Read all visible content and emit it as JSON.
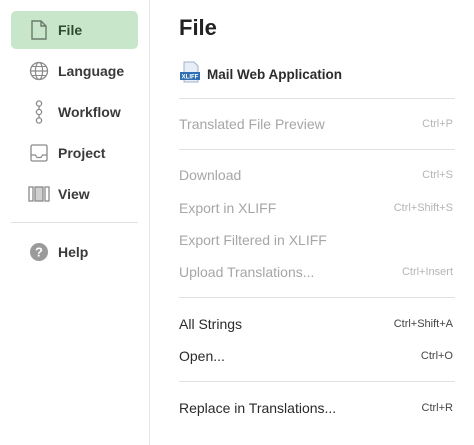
{
  "sidebar": {
    "items": [
      {
        "label": "File",
        "icon": "file-icon",
        "active": true
      },
      {
        "label": "Language",
        "icon": "globe-icon"
      },
      {
        "label": "Workflow",
        "icon": "workflow-icon"
      },
      {
        "label": "Project",
        "icon": "inbox-icon"
      },
      {
        "label": "View",
        "icon": "columns-icon"
      }
    ],
    "help": {
      "label": "Help",
      "icon": "help-icon"
    }
  },
  "main": {
    "title": "File",
    "project": {
      "name": "Mail Web Application",
      "icon_text": "XLIFF"
    },
    "menu": [
      {
        "label": "Translated File Preview",
        "shortcut": "Ctrl+P",
        "enabled": false
      },
      {
        "label": "Download",
        "shortcut": "Ctrl+S",
        "enabled": false
      },
      {
        "label": "Export in XLIFF",
        "shortcut": "Ctrl+Shift+S",
        "enabled": false
      },
      {
        "label": "Export Filtered in XLIFF",
        "shortcut": "",
        "enabled": false
      },
      {
        "label": "Upload Translations...",
        "shortcut": "Ctrl+Insert",
        "enabled": false
      },
      {
        "label": "All Strings",
        "shortcut": "Ctrl+Shift+A",
        "enabled": true
      },
      {
        "label": "Open...",
        "shortcut": "Ctrl+O",
        "enabled": true
      },
      {
        "label": "Replace in Translations...",
        "shortcut": "Ctrl+R",
        "enabled": true
      }
    ]
  },
  "colors": {
    "active_bg": "#c8e6c9",
    "disabled_text": "#a6a6a6",
    "xliff_blue": "#2f6fb3"
  }
}
